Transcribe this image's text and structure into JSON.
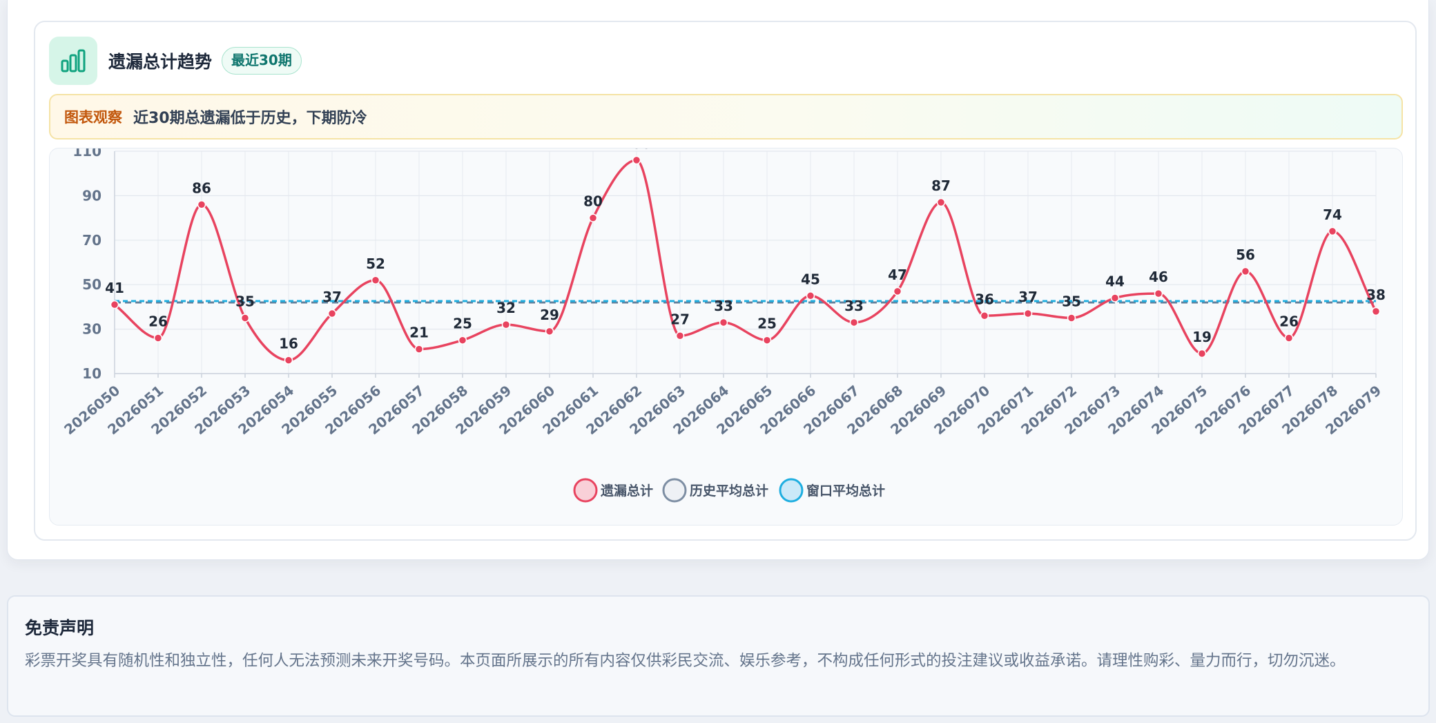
{
  "card": {
    "icon": "bar-chart-icon",
    "title": "遗漏总计趋势",
    "badge": "最近30期"
  },
  "notice": {
    "tag": "图表观察",
    "text": "近30期总遗漏低于历史，下期防冷"
  },
  "colors": {
    "series_line": "#e8435f",
    "history_avg_line": "#64809a",
    "window_avg_line": "#1eaee0",
    "accent_green": "#0f766e"
  },
  "chart_data": {
    "type": "line",
    "categories": [
      "2026050",
      "2026051",
      "2026052",
      "2026053",
      "2026054",
      "2026055",
      "2026056",
      "2026057",
      "2026058",
      "2026059",
      "2026060",
      "2026061",
      "2026062",
      "2026063",
      "2026064",
      "2026065",
      "2026066",
      "2026067",
      "2026068",
      "2026069",
      "2026070",
      "2026071",
      "2026072",
      "2026073",
      "2026074",
      "2026075",
      "2026076",
      "2026077",
      "2026078",
      "2026079"
    ],
    "series": [
      {
        "name": "遗漏总计",
        "values": [
          41,
          26,
          86,
          35,
          16,
          37,
          52,
          21,
          25,
          32,
          29,
          80,
          106,
          27,
          33,
          25,
          45,
          33,
          47,
          87,
          36,
          37,
          35,
          44,
          46,
          19,
          56,
          26,
          74,
          38
        ],
        "smooth": true,
        "data_labels": true
      },
      {
        "name": "历史平均总计",
        "value": 42,
        "style": "dashed"
      },
      {
        "name": "窗口平均总计",
        "value": 42.6,
        "style": "dashed"
      }
    ],
    "yticks": [
      10,
      30,
      50,
      70,
      90,
      110
    ],
    "ylim": [
      10,
      110
    ],
    "grid": true,
    "legend_position": "bottom-center",
    "xlabel": "",
    "ylabel": ""
  },
  "disclaimer": {
    "title": "免责声明",
    "text": "彩票开奖具有随机性和独立性，任何人无法预测未来开奖号码。本页面所展示的所有内容仅供彩民交流、娱乐参考，不构成任何形式的投注建议或收益承诺。请理性购彩、量力而行，切勿沉迷。"
  }
}
